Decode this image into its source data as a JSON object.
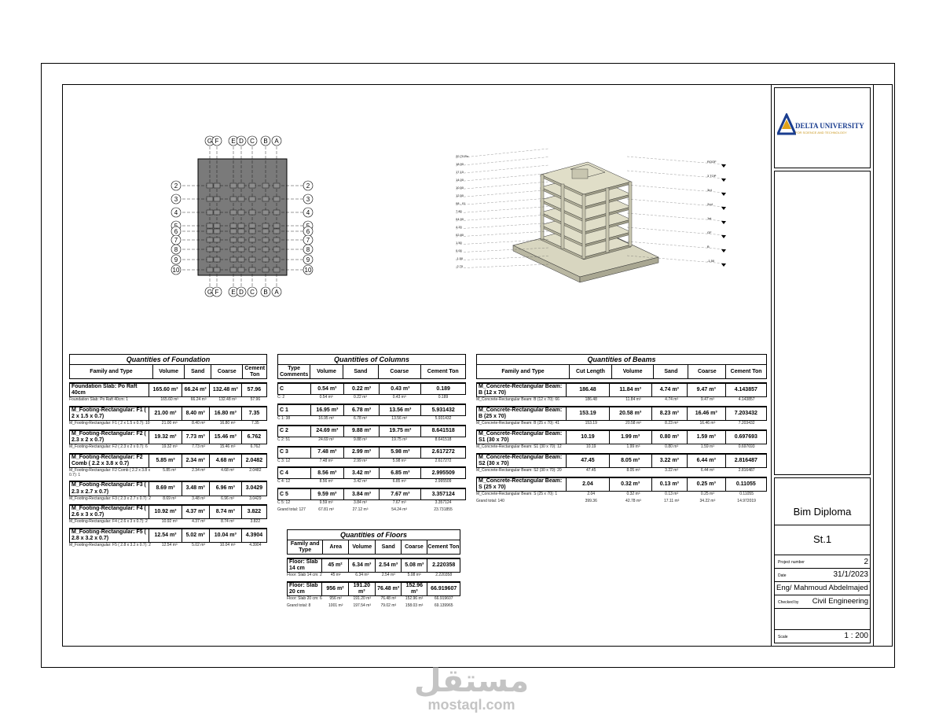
{
  "plan": {
    "grid_letters": [
      "G",
      "F",
      "E",
      "D",
      "C",
      "B",
      "A"
    ],
    "grid_numbers": [
      "2",
      "3",
      "4",
      "5",
      "6",
      "7",
      "8",
      "9",
      "10"
    ]
  },
  "elevations": {
    "left": [
      "20.70 Ro",
      "18.90",
      "17.10",
      "14.00",
      "10.50",
      "12.50",
      "08 - 01",
      "7.80",
      "04.90",
      "4.20",
      "02.80",
      "1.50",
      "0.00",
      "-1.50",
      "-2.70"
    ],
    "right": [
      "ROOF",
      "3 TOP",
      "3rd",
      "2nd",
      "1st",
      "GF",
      "B",
      "-1.50"
    ]
  },
  "foundation": {
    "title": "Quantities of Foundation",
    "headers": [
      "Family and Type",
      "Volume",
      "Sand",
      "Coarse",
      "Cement Ton"
    ],
    "groups": [
      {
        "head": [
          "Foundation Slab: Po Raft 40cm",
          "165.60 m³",
          "66.24 m³",
          "132.48 m³",
          "57.96"
        ],
        "detail": [
          "Foundation Slab: Po Raft 40cm: 1",
          "165.60 m³",
          "66.24 m³",
          "132.48 m³",
          "57.96"
        ]
      },
      {
        "head": [
          "M_Footing-Rectangular: F1 ( 2 x 1.5 x 0.7)",
          "21.00 m³",
          "8.40 m³",
          "16.80 m³",
          "7.35"
        ],
        "detail": [
          "M_Footing-Rectangular: F1 ( 2 x 1.5 x 0.7): 10",
          "21.00 m³",
          "8.40 m³",
          "16.80 m³",
          "7.35"
        ]
      },
      {
        "head": [
          "M_Footing-Rectangular: F2 ( 2.3 x 2 x 0.7)",
          "19.32 m³",
          "7.73 m³",
          "15.46 m³",
          "6.762"
        ],
        "detail": [
          "M_Footing-Rectangular: F2 ( 2.3 x 2 x 0.7): 6",
          "19.32 m³",
          "7.73 m³",
          "15.46 m³",
          "6.762"
        ]
      },
      {
        "head": [
          "M_Footing-Rectangular: F2 Comb ( 2.2 x 3.8 x 0.7)",
          "5.85 m³",
          "2.34 m³",
          "4.68 m³",
          "2.0482"
        ],
        "detail": [
          "M_Footing-Rectangular: F2 Comb ( 2.2 x 3.8 x 0.7): 1",
          "5.85 m³",
          "2.34 m³",
          "4.68 m³",
          "2.0482"
        ]
      },
      {
        "head": [
          "M_Footing-Rectangular: F3 ( 2.3 x 2.7 x 0.7)",
          "8.69 m³",
          "3.48 m³",
          "6.96 m³",
          "3.0429"
        ],
        "detail": [
          "M_Footing-Rectangular: F3 ( 2.3 x 2.7 x 0.7): 2",
          "8.69 m³",
          "3.48 m³",
          "6.96 m³",
          "3.0429"
        ]
      },
      {
        "head": [
          "M_Footing-Rectangular: F4 ( 2.6 x 3 x 0.7)",
          "10.92 m³",
          "4.37 m³",
          "8.74 m³",
          "3.822"
        ],
        "detail": [
          "M_Footing-Rectangular: F4 ( 2.6 x 3 x 0.7): 2",
          "10.92 m³",
          "4.37 m³",
          "8.74 m³",
          "3.822"
        ]
      },
      {
        "head": [
          "M_Footing-Rectangular: F5 ( 2.8 x 3.2 x 0.7)",
          "12.54 m³",
          "5.02 m³",
          "10.04 m³",
          "4.3904"
        ],
        "detail": [
          "M_Footing-Rectangular: F5 ( 2.8 x 3.2 x 0.7): 2",
          "12.54 m³",
          "5.02 m³",
          "10.04 m³",
          "4.3904"
        ]
      }
    ]
  },
  "columns": {
    "title": "Quantities of Columns",
    "headers": [
      "Type Comments",
      "Volume",
      "Sand",
      "Coarse",
      "Cement Ton"
    ],
    "groups": [
      {
        "head": [
          "C",
          "0.54 m³",
          "0.22 m³",
          "0.43 m³",
          "0.189"
        ],
        "detail": [
          "C: 2",
          "0.54 m³",
          "0.22 m³",
          "0.43 m³",
          "0.189"
        ]
      },
      {
        "head": [
          "C 1",
          "16.95 m³",
          "6.78 m³",
          "13.56 m³",
          "5.931432"
        ],
        "detail": [
          "C 1: 38",
          "16.95 m³",
          "6.78 m³",
          "13.56 m³",
          "5.931432"
        ]
      },
      {
        "head": [
          "C 2",
          "24.69 m³",
          "9.88 m³",
          "19.75 m³",
          "8.641518"
        ],
        "detail": [
          "C 2: 51",
          "24.69 m³",
          "9.88 m³",
          "19.75 m³",
          "8.641518"
        ]
      },
      {
        "head": [
          "C 3",
          "7.48 m³",
          "2.99 m³",
          "5.98 m³",
          "2.617272"
        ],
        "detail": [
          "C 3: 12",
          "7.48 m³",
          "2.99 m³",
          "5.98 m³",
          "2.617272"
        ]
      },
      {
        "head": [
          "C 4",
          "8.56 m³",
          "3.42 m³",
          "6.85 m³",
          "2.995509"
        ],
        "detail": [
          "C 4: 12",
          "8.56 m³",
          "3.42 m³",
          "6.85 m³",
          "2.995509"
        ]
      },
      {
        "head": [
          "C 5",
          "9.59 m³",
          "3.84 m³",
          "7.67 m³",
          "3.357124"
        ],
        "detail": [
          "C 5: 12",
          "9.59 m³",
          "3.84 m³",
          "7.67 m³",
          "3.357124"
        ]
      }
    ],
    "total": [
      "Grand total: 127",
      "67.81 m³",
      "27.12 m³",
      "54.24 m³",
      "23.731855"
    ]
  },
  "beams": {
    "title": "Quantities of Beams",
    "headers": [
      "Family and Type",
      "Cut Length",
      "Volume",
      "Sand",
      "Coarse",
      "Cement Ton"
    ],
    "groups": [
      {
        "head": [
          "M_Concrete-Rectangular Beam: B (12 x 70)",
          "186.48",
          "11.84 m³",
          "4.74 m³",
          "9.47 m³",
          "4.143857"
        ],
        "detail": [
          "M_Concrete-Rectangular Beam: B (12 x 70): 66",
          "186.48",
          "11.84 m³",
          "4.74 m³",
          "9.47 m³",
          "4.143857"
        ]
      },
      {
        "head": [
          "M_Concrete-Rectangular Beam: B (25 x 70)",
          "153.19",
          "20.58 m³",
          "8.23 m³",
          "16.46 m³",
          "7.203432"
        ],
        "detail": [
          "M_Concrete-Rectangular Beam: B (25 x 70): 41",
          "153.19",
          "20.58 m³",
          "8.23 m³",
          "16.46 m³",
          "7.203432"
        ]
      },
      {
        "head": [
          "M_Concrete-Rectangular Beam: S1 (30 x 70)",
          "10.19",
          "1.99 m³",
          "0.80 m³",
          "1.59 m³",
          "0.697693"
        ],
        "detail": [
          "M_Concrete-Rectangular Beam: S1 (30 x 70): 12",
          "10.19",
          "1.99 m³",
          "0.80 m³",
          "1.59 m³",
          "0.697693"
        ]
      },
      {
        "head": [
          "M_Concrete-Rectangular Beam: S2 (30 x 70)",
          "47.45",
          "8.05 m³",
          "3.22 m³",
          "6.44 m³",
          "2.816487"
        ],
        "detail": [
          "M_Concrete-Rectangular Beam: S2 (30 x 70): 20",
          "47.45",
          "8.05 m³",
          "3.22 m³",
          "6.44 m³",
          "2.816487"
        ]
      },
      {
        "head": [
          "M_Concrete-Rectangular Beam: S (25 x 70)",
          "2.04",
          "0.32 m³",
          "0.13 m³",
          "0.25 m³",
          "0.11055"
        ],
        "detail": [
          "M_Concrete-Rectangular Beam: S (25 x 70): 1",
          "2.04",
          "0.32 m³",
          "0.13 m³",
          "0.25 m³",
          "0.11055"
        ]
      }
    ],
    "total": [
      "Grand total: 140",
      "399.36",
      "42.78 m³",
      "17.11 m³",
      "34.22 m³",
      "14.972019"
    ]
  },
  "floors": {
    "title": "Quantities of Floors",
    "headers": [
      "Family and Type",
      "Area",
      "Volume",
      "Sand",
      "Coarse",
      "Cement Ton"
    ],
    "groups": [
      {
        "head": [
          "Floor: Slab 14 cm",
          "45 m²",
          "6.34 m³",
          "2.54 m³",
          "5.08 m³",
          "2.220358"
        ],
        "detail": [
          "Floor: Slab 14 cm: 2",
          "45 m²",
          "6.34 m³",
          "2.54 m³",
          "5.08 m³",
          "2.220358"
        ]
      },
      {
        "head": [
          "Floor: Slab 20 cm",
          "956 m²",
          "191.20 m³",
          "76.48 m³",
          "152.96 m³",
          "66.919607"
        ],
        "detail": [
          "Floor: Slab 20 cm: 6",
          "956 m²",
          "191.20 m³",
          "76.48 m³",
          "152.96 m³",
          "66.919607"
        ]
      }
    ],
    "total": [
      "Grand total: 8",
      "1001 m²",
      "197.54 m³",
      "79.02 m³",
      "158.03 m³",
      "69.139965"
    ]
  },
  "titleblock": {
    "logo_text": "DELTA UNIVERSITY",
    "logo_sub": "FOR SCIENCE AND TECHNOLOGY",
    "project_name": "Bim Diploma",
    "sheet_number": "St.1",
    "project_number_label": "Project number",
    "project_number": "2",
    "date_label": "Date",
    "date": "31/1/2023",
    "author": "Eng/ Mahmoud Abdelmajed",
    "checked_label": "Checked by",
    "checked": "Civil Engineering",
    "scale_label": "Scale",
    "scale": "1 : 200"
  },
  "watermark": {
    "arabic": "مستقل",
    "latin": "mostaql.com"
  }
}
